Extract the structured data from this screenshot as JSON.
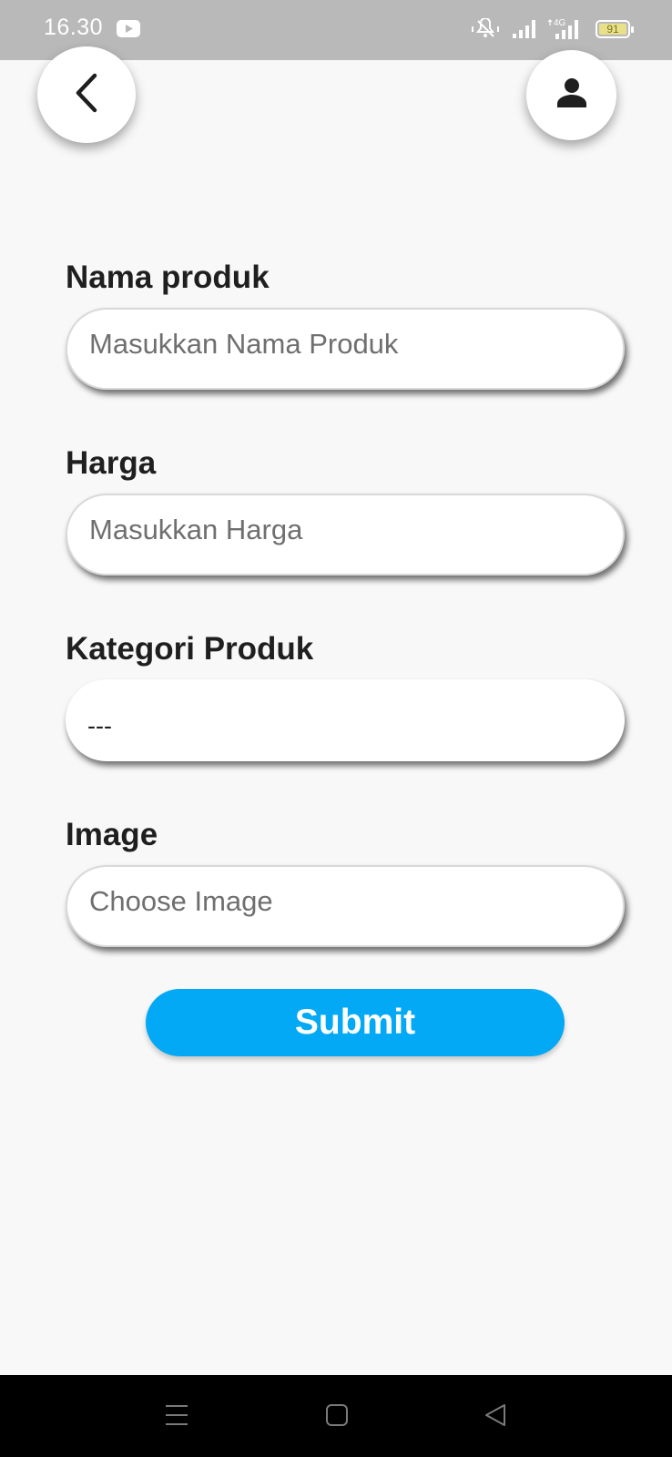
{
  "status_bar": {
    "time": "16.30",
    "battery_level": "91",
    "network": "4G",
    "icons": [
      "youtube-icon",
      "mute-vibrate-icon",
      "signal-icon",
      "signal-4g-icon",
      "battery-icon"
    ]
  },
  "header": {
    "back_icon": "chevron-left-icon",
    "profile_icon": "person-icon"
  },
  "form": {
    "name": {
      "label": "Nama produk",
      "placeholder": "Masukkan Nama Produk"
    },
    "price": {
      "label": "Harga",
      "placeholder": "Masukkan Harga"
    },
    "category": {
      "label": "Kategori Produk",
      "selected": "---"
    },
    "image": {
      "label": "Image",
      "placeholder": "Choose Image"
    },
    "submit_label": "Submit"
  },
  "colors": {
    "accent": "#03a9f4",
    "status_bar": "#b9b9b9",
    "background": "#f8f8f8",
    "nav_bar": "#000000"
  },
  "nav_bar": {
    "icons": [
      "menu-icon",
      "home-square-icon",
      "back-triangle-icon"
    ]
  }
}
